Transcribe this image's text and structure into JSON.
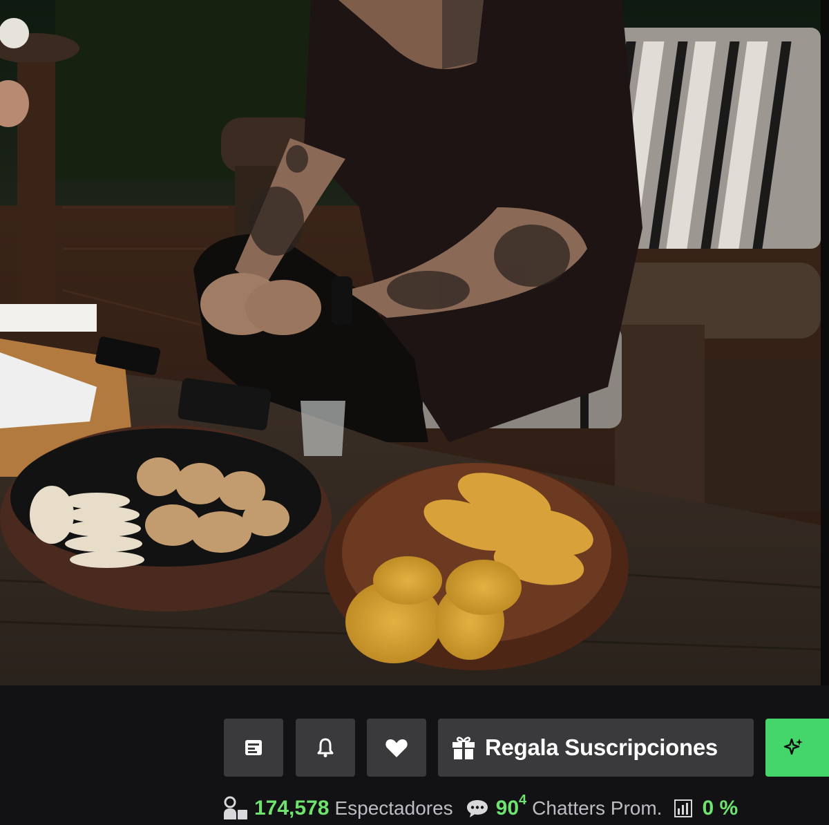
{
  "video": {
    "description_icon": "video-thumbnail"
  },
  "actions": {
    "icons": [
      "notes-icon",
      "bell-icon",
      "heart-icon",
      "gift-icon",
      "sparkle-icon"
    ],
    "gift_label": "Regala Suscripciones"
  },
  "stats": {
    "viewers_count": "174,578",
    "viewers_label": "Espectadores",
    "chatters_count": "90",
    "chatters_superscript": "4",
    "chatters_label": "Chatters Prom.",
    "percent_value": "0 %"
  },
  "colors": {
    "accent_green": "#45d66b",
    "stat_green": "#6ee36e",
    "button_bg": "#3a3a3d",
    "bar_bg": "#121214"
  }
}
